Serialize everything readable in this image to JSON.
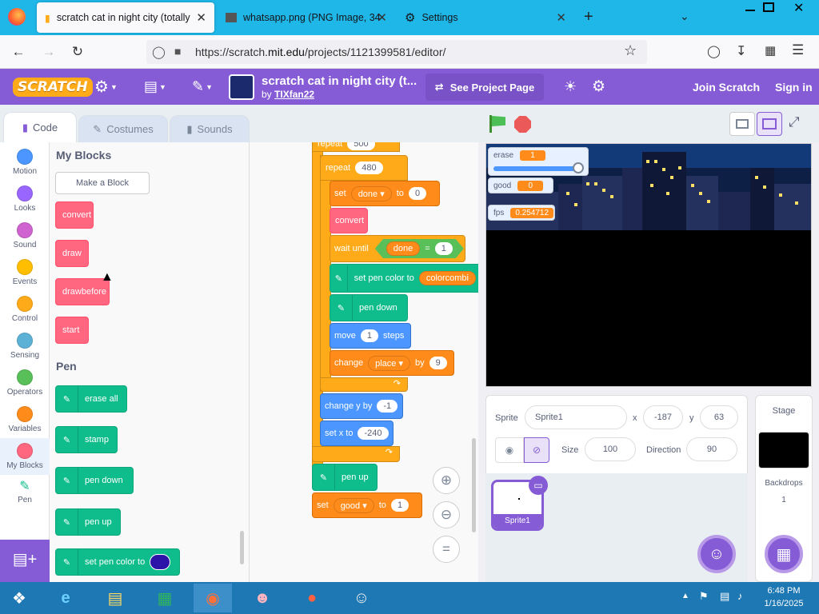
{
  "browser": {
    "tabs": [
      {
        "title": "scratch cat in night city (totally",
        "active": true
      },
      {
        "title": "whatsapp.png (PNG Image, 34",
        "active": false
      },
      {
        "title": "Settings",
        "active": false
      }
    ],
    "url_prefix": "https://scratch.",
    "url_domain": "mit.edu",
    "url_path": "/projects/1121399581/editor/"
  },
  "menubar": {
    "logo": "SCRATCH",
    "project_title": "scratch cat in night city (t...",
    "author_prefix": "by",
    "author": "TIXfan22",
    "see_project": "See Project Page",
    "join": "Join Scratch",
    "signin": "Sign in"
  },
  "editor_tabs": [
    "Code",
    "Costumes",
    "Sounds"
  ],
  "categories": [
    {
      "label": "Motion",
      "color": "#4c97ff"
    },
    {
      "label": "Looks",
      "color": "#9966ff"
    },
    {
      "label": "Sound",
      "color": "#cf63cf"
    },
    {
      "label": "Events",
      "color": "#ffbf00"
    },
    {
      "label": "Control",
      "color": "#ffab19"
    },
    {
      "label": "Sensing",
      "color": "#5cb1d6"
    },
    {
      "label": "Operators",
      "color": "#59c059"
    },
    {
      "label": "Variables",
      "color": "#ff8c1a"
    },
    {
      "label": "My Blocks",
      "color": "#ff6680"
    },
    {
      "label": "Pen",
      "color": "#0fbd8c"
    }
  ],
  "palette": {
    "myblocks_title": "My Blocks",
    "make_block": "Make a Block",
    "custom": [
      "convert",
      "draw",
      "drawbefore",
      "start"
    ],
    "pen_title": "Pen",
    "pen_blocks": [
      "erase all",
      "stamp",
      "pen down",
      "pen up",
      "set pen color to"
    ]
  },
  "script": {
    "repeat_outer": "repeat",
    "repeat_outer_val": "500",
    "repeat": "repeat",
    "repeat_val": "480",
    "set": "set",
    "done_var": "done",
    "to": "to",
    "set_val": "0",
    "convert": "convert",
    "wait_until": "wait until",
    "eq": "=",
    "eq_val": "1",
    "set_pen_color": "set pen color to",
    "colorcomb": "colorcombi",
    "pen_down": "pen down",
    "move": "move",
    "move_val": "1",
    "steps": "steps",
    "change": "change",
    "place_var": "place",
    "by": "by",
    "change_val": "9",
    "change_y": "change y by",
    "change_y_val": "-1",
    "set_x": "set x to",
    "set_x_val": "-240",
    "pen_up": "pen up",
    "good_var": "good",
    "set2_val": "1"
  },
  "stage": {
    "monitors": [
      {
        "label": "erase",
        "value": "1"
      },
      {
        "label": "good",
        "value": "0"
      },
      {
        "label": "fps",
        "value": "0.254712"
      }
    ],
    "slider_level": 0.95
  },
  "sprite_info": {
    "sprite_label": "Sprite",
    "sprite_name": "Sprite1",
    "x_label": "x",
    "x": "-187",
    "y_label": "y",
    "y": "63",
    "size_label": "Size",
    "size": "100",
    "direction_label": "Direction",
    "direction": "90",
    "thumb_name": "Sprite1"
  },
  "stage_panel": {
    "title": "Stage",
    "backdrops_label": "Backdrops",
    "backdrops_count": "1"
  },
  "taskbar": {
    "time": "6:48 PM",
    "date": "1/16/2025"
  }
}
